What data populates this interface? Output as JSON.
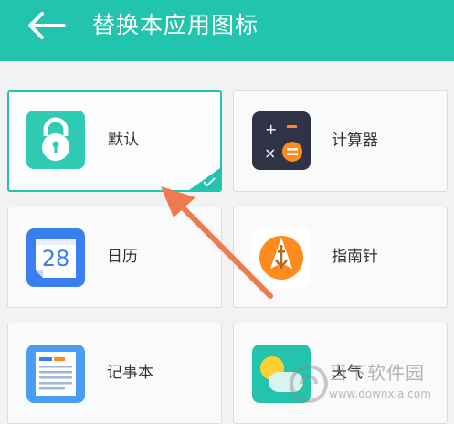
{
  "header": {
    "title": "替换本应用图标",
    "back_icon": "arrow-left-icon"
  },
  "cards": [
    {
      "label": "默认",
      "icon": "lock-icon",
      "selected": true
    },
    {
      "label": "计算器",
      "icon": "calculator-icon",
      "selected": false
    },
    {
      "label": "日历",
      "icon": "calendar-icon",
      "calendar_day": "28",
      "selected": false
    },
    {
      "label": "指南针",
      "icon": "compass-icon",
      "selected": false
    },
    {
      "label": "记事本",
      "icon": "notepad-icon",
      "selected": false
    },
    {
      "label": "天气",
      "icon": "weather-icon",
      "selected": false
    }
  ],
  "watermark": {
    "text": "当下软件园",
    "url": "www.downxia.com"
  },
  "colors": {
    "accent": "#22c4ad",
    "annotation_arrow": "#f07a4f"
  }
}
